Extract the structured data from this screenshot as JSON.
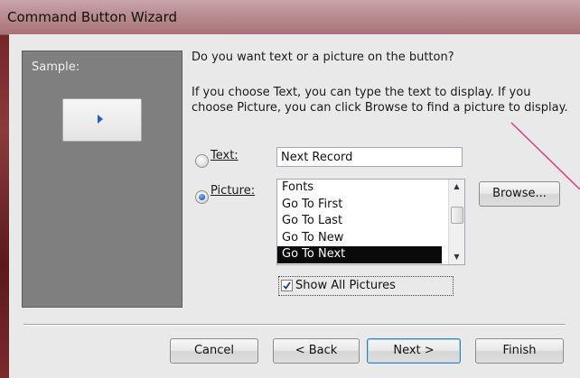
{
  "window": {
    "title": "Command Button Wizard"
  },
  "sample": {
    "label": "Sample:"
  },
  "question": "Do you want text or a picture on the button?",
  "info": "If you choose Text, you can type the text to display.  If you choose Picture, you can click Browse to find a picture to display.",
  "options": {
    "text_label": "Text:",
    "text_value": "Next Record",
    "picture_label": "Picture:",
    "selected": "Picture"
  },
  "picture_list": {
    "items": [
      "Fonts",
      "Go To First",
      "Go To Last",
      "Go To New",
      "Go To Next"
    ],
    "selected": "Go To Next"
  },
  "browse_label": "Browse...",
  "show_all": {
    "label": "Show All Pictures",
    "checked": true
  },
  "footer": {
    "cancel": "Cancel",
    "back": "< Back",
    "next": "Next >",
    "finish": "Finish"
  },
  "colors": {
    "accent": "#2a63c8",
    "selection": "#0a0a0a",
    "annotation": "#d63c8c"
  },
  "icons": {
    "sample_button": "right-triangle-icon",
    "check": "checkmark-icon"
  }
}
